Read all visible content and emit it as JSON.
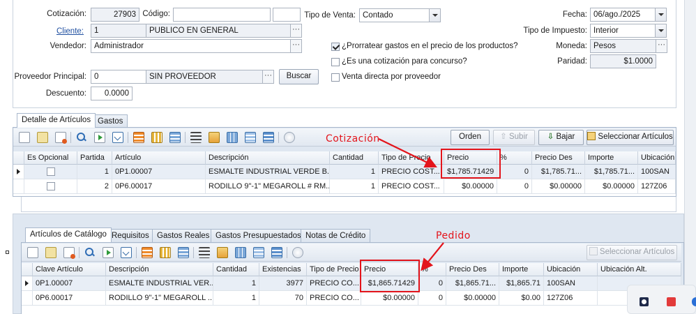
{
  "header": {
    "cotizacion_label": "Cotización:",
    "cotizacion_value": "27903",
    "codigo_label": "Código:",
    "codigo_value": "",
    "codigo_extra_value": "",
    "tipo_venta_label": "Tipo de Venta:",
    "tipo_venta_value": "Contado",
    "fecha_label": "Fecha:",
    "fecha_value": "06/ago./2025",
    "cliente_label": "Cliente:",
    "cliente_id": "1",
    "cliente_name": "PUBLICO EN GENERAL",
    "tipo_impuesto_label": "Tipo de Impuesto:",
    "tipo_impuesto_value": "Interior",
    "vendedor_label": "Vendedor:",
    "vendedor_value": "Administrador",
    "prorratear_label": "¿Prorratear gastos en el precio de los productos?",
    "prorratear_checked": true,
    "concurso_label": "¿Es una cotización para concurso?",
    "concurso_checked": false,
    "venta_directa_label": "Venta directa por proveedor",
    "venta_directa_checked": false,
    "moneda_label": "Moneda:",
    "moneda_value": "Pesos",
    "paridad_label": "Paridad:",
    "paridad_value": "$1.0000",
    "proveedor_label": "Proveedor Principal:",
    "proveedor_id": "0",
    "proveedor_name": "SIN PROVEEDOR",
    "buscar_label": "Buscar",
    "descuento_label": "Descuento:",
    "descuento_value": "0.0000",
    "ellipsis": "···"
  },
  "top_tabs": [
    "Detalle de Artículos",
    "Gastos"
  ],
  "top_toolbar": {
    "orden_label": "Orden",
    "subir_label": "Subir",
    "bajar_label": "Bajar",
    "seleccionar_label": "Seleccionar Artículos"
  },
  "top_grid": {
    "headers": [
      "Es Opcional",
      "Partida",
      "Artículo",
      "Descripción",
      "Cantidad",
      "Tipo de Precio",
      "Precio",
      "%",
      "Precio Des",
      "Importe",
      "Ubicación"
    ],
    "rows": [
      {
        "partida": "1",
        "articulo": "0P1.00007",
        "descripcion": "ESMALTE INDUSTRIAL VERDE B...",
        "cantidad": "1",
        "tipo_precio": "PRECIO COST...",
        "precio": "$1,785.71429",
        "pct": "0",
        "precio_des": "$1,785.71...",
        "importe": "$1,785.71...",
        "ubicacion": "100SAN"
      },
      {
        "partida": "2",
        "articulo": "0P6.00017",
        "descripcion": "RODILLO 9\"-1\" MEGAROLL # RM...",
        "cantidad": "1",
        "tipo_precio": "PRECIO COST...",
        "precio": "$0.00000",
        "pct": "0",
        "precio_des": "$0.00000",
        "importe": "$0.00000",
        "ubicacion": "127Z06"
      }
    ]
  },
  "annotations": {
    "cotizacion": "Cotización",
    "pedido": "Pedido",
    "color": "#e3141b"
  },
  "bottom_tabs": [
    "Artículos de Catálogo",
    "Requisitos",
    "Gastos Reales",
    "Gastos Presupuestados",
    "Notas de Crédito"
  ],
  "bottom_toolbar": {
    "seleccionar_label": "Seleccionar Artículos"
  },
  "bottom_grid": {
    "headers": [
      "Clave Artículo",
      "Descripción",
      "Cantidad",
      "Existencias",
      "Tipo de Precio",
      "Precio",
      "%",
      "Precio Des",
      "Importe",
      "Ubicación",
      "Ubicación Alt."
    ],
    "rows": [
      {
        "clave": "0P1.00007",
        "descripcion": "ESMALTE INDUSTRIAL VER...",
        "cantidad": "1",
        "existencias": "3977",
        "tipo_precio": "PRECIO CO...",
        "precio": "$1,865.71429",
        "pct": "0",
        "precio_des": "$1,865.71...",
        "importe": "$1,865.71",
        "ubicacion": "100SAN",
        "ubicacion_alt": ""
      },
      {
        "clave": "0P6.00017",
        "descripcion": "RODILLO 9\"-1\" MEGAROLL ...",
        "cantidad": "1",
        "existencias": "70",
        "tipo_precio": "PRECIO CO...",
        "precio": "$0.00000",
        "pct": "0",
        "precio_des": "$0.00000",
        "importe": "$0.00",
        "ubicacion": "127Z06",
        "ubicacion_alt": ""
      }
    ]
  }
}
